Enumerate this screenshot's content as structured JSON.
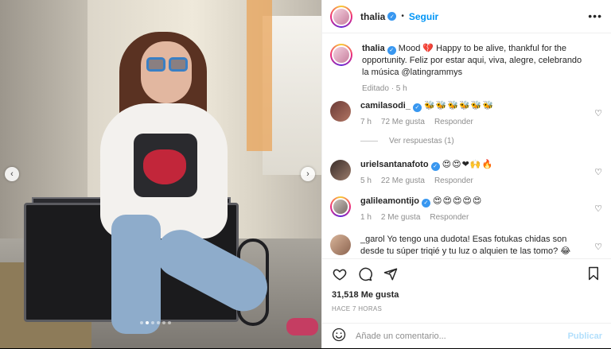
{
  "post": {
    "username": "thalia",
    "follow_label": "Seguir",
    "separator": "•",
    "more_label": "•••",
    "caption_user": "thalia",
    "caption_text": "Mood 💔 Happy to be alive, thankful for the opportunity. Feliz por estar aqui, viva, alegre, celebrando la música @latingrammys",
    "edited": "Editado · 5 h",
    "likes": "31,518 Me gusta",
    "time_ago": "HACE 7 HORAS"
  },
  "carousel": {
    "prev_icon": "‹",
    "next_icon": "›",
    "slide_count": 6,
    "active_slide": 1
  },
  "comments": [
    {
      "user": "camilasodi_",
      "text": "🐝🐝🐝🐝🐝🐝",
      "time": "7 h",
      "likes": "72 Me gusta",
      "reply": "Responder",
      "replies": "Ver respuestas (1)"
    },
    {
      "user": "urielsantanafoto",
      "text": "😍😍❤🙌🔥",
      "time": "5 h",
      "likes": "22 Me gusta",
      "reply": "Responder"
    },
    {
      "user": "galileamontijo",
      "text": "😍😍😍😍😍",
      "time": "1 h",
      "likes": "2 Me gusta",
      "reply": "Responder"
    },
    {
      "user": "_garol",
      "text": "Yo tengo una dudota! Esas fotukas chidas son desde tu súper triqié y tu luz o alquien te las tomo? 😂",
      "time": "",
      "likes": "",
      "reply": ""
    }
  ],
  "composer": {
    "placeholder": "Añade un comentario...",
    "publish_label": "Publicar"
  },
  "icons": {
    "like": "heart-icon",
    "comment": "comment-icon",
    "share": "share-icon",
    "save": "bookmark-icon",
    "emoji": "smile-icon"
  },
  "colors": {
    "accent": "#0095f6",
    "verified": "#3897f0",
    "muted": "#8e8e8e",
    "publish_disabled": "#b2dffc"
  }
}
